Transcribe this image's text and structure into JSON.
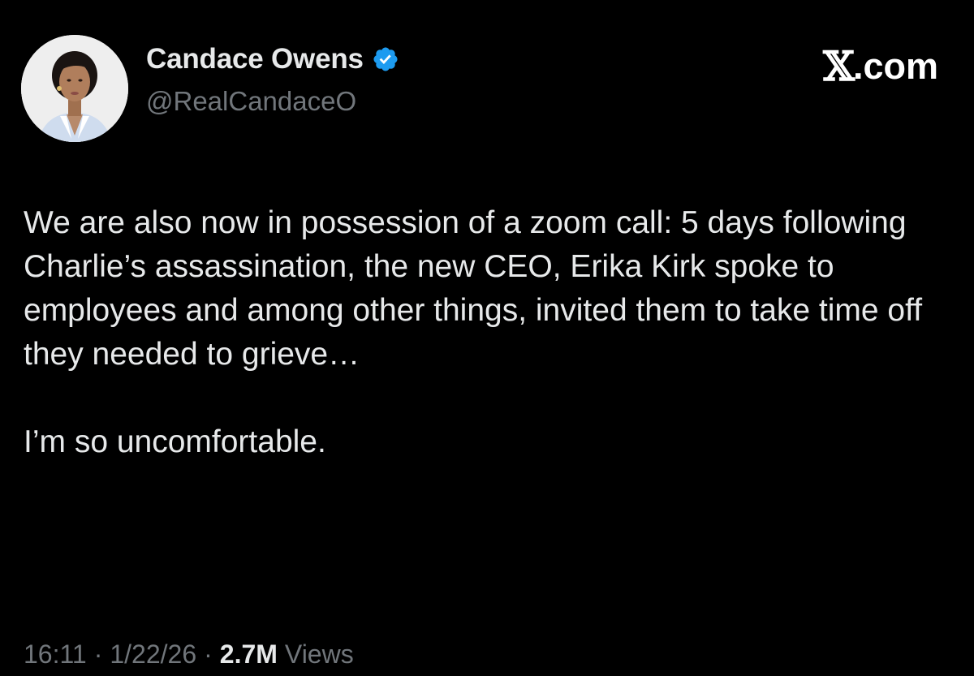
{
  "author": {
    "display_name": "Candace Owens",
    "handle": "@RealCandaceO",
    "verified_icon": "verified-badge-icon",
    "verified_color": "#1d9bf0"
  },
  "site": {
    "logo": "x-logo-icon",
    "logo_text": "𝕏",
    "suffix": ".com"
  },
  "tweet": {
    "paragraph_1": "We are also now in possession of a zoom call: 5 days following Charlie’s assassination, the new CEO, Erika Kirk spoke to employees and among other things, invited them to take time off they needed to grieve…",
    "paragraph_2": "I’m so uncomfortable."
  },
  "meta": {
    "time": "16:11",
    "separator": "·",
    "date": "1/22/26",
    "views_count": "2.7M",
    "views_label": "Views"
  },
  "colors": {
    "background": "#000000",
    "primary_text": "#e7e9ea",
    "secondary_text": "#71767b",
    "accent": "#1d9bf0"
  }
}
